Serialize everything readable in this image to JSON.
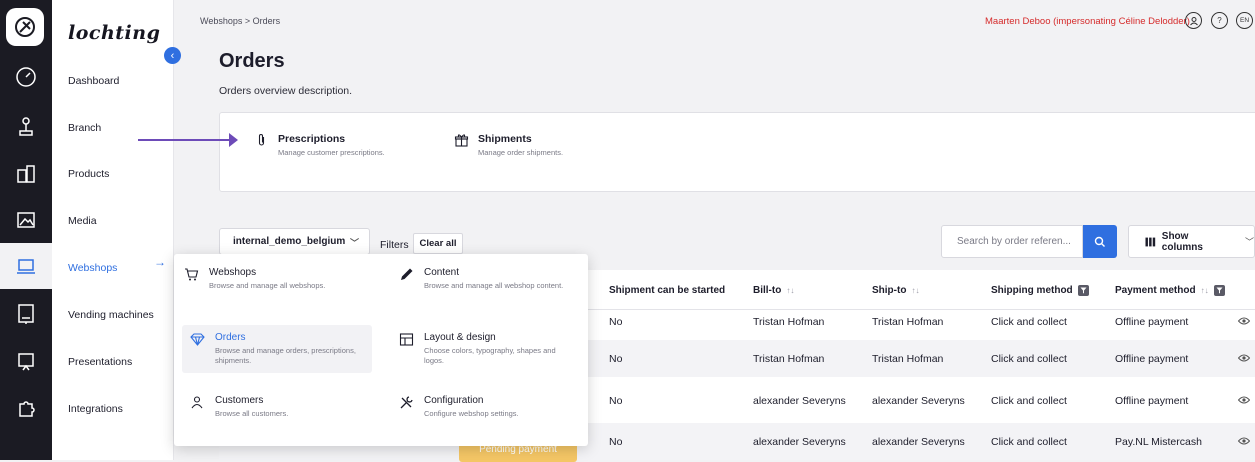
{
  "brand": {
    "name": "lochting"
  },
  "breadcrumb": [
    "Webshops",
    ">",
    "Orders"
  ],
  "header": {
    "impersonation": "Maarten Deboo (impersonating Céline Delodder)",
    "language": "EN",
    "help": "?"
  },
  "sidebar": {
    "items": [
      {
        "label": "Dashboard",
        "icon": "gauge-icon"
      },
      {
        "label": "Branch",
        "icon": "joystick-icon"
      },
      {
        "label": "Products",
        "icon": "products-icon"
      },
      {
        "label": "Media",
        "icon": "image-icon"
      },
      {
        "label": "Webshops",
        "icon": "laptop-cart-icon",
        "active": true
      },
      {
        "label": "Vending machines",
        "icon": "vending-machine-icon"
      },
      {
        "label": "Presentations",
        "icon": "presentation-icon"
      },
      {
        "label": "Integrations",
        "icon": "puzzle-icon"
      }
    ],
    "active_arrow": "→"
  },
  "page": {
    "title": "Orders",
    "description": "Orders overview description."
  },
  "links": [
    {
      "title": "Prescriptions",
      "subtitle": "Manage customer prescriptions.",
      "icon": "paperclip-icon"
    },
    {
      "title": "Shipments",
      "subtitle": "Manage order shipments.",
      "icon": "gift-icon"
    }
  ],
  "filterbar": {
    "webshop": "internal_demo_belgium",
    "filters_label": "Filters",
    "clear_label": "Clear all",
    "search_placeholder": "Search by order referen...",
    "columns_label": "Show columns"
  },
  "table": {
    "headers": [
      "Shipment can be started",
      "Bill-to",
      "Ship-to",
      "Shipping method",
      "Payment method"
    ],
    "rows": [
      [
        "No",
        "Tristan Hofman",
        "Tristan Hofman",
        "Click and collect",
        "Offline payment"
      ],
      [
        "No",
        "Tristan Hofman",
        "Tristan Hofman",
        "Click and collect",
        "Offline payment"
      ],
      [
        "No",
        "alexander Severyns",
        "alexander Severyns",
        "Click and collect",
        "Offline payment"
      ],
      [
        "No",
        "alexander Severyns",
        "alexander Severyns",
        "Click and collect",
        "Pay.NL Mistercash"
      ]
    ],
    "status_badge": "Pending payment"
  },
  "mega_menu": {
    "left": [
      {
        "title": "Webshops",
        "subtitle": "Browse and manage all webshops.",
        "icon": "cart-icon"
      },
      {
        "title": "Orders",
        "subtitle": "Browse and manage orders, prescriptions, shipments.",
        "icon": "diamond-icon",
        "active": true
      },
      {
        "title": "Customers",
        "subtitle": "Browse all customers.",
        "icon": "customers-icon"
      }
    ],
    "right": [
      {
        "title": "Content",
        "subtitle": "Browse and manage all webshop content.",
        "icon": "pencil-icon"
      },
      {
        "title": "Layout & design",
        "subtitle": "Choose colors, typography, shapes and logos.",
        "icon": "layout-icon"
      },
      {
        "title": "Configuration",
        "subtitle": "Configure webshop settings.",
        "icon": "tools-icon"
      }
    ]
  },
  "colors": {
    "accent": "#2f6fe0",
    "impersonation": "#d52b2b",
    "annotation": "#6d4bb8",
    "badge": "#f5c766"
  }
}
